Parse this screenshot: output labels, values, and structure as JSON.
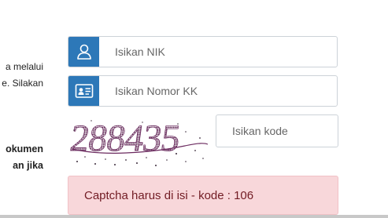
{
  "left_fragments": [
    {
      "text": "a melalui",
      "bold": false
    },
    {
      "text": "e. Silakan",
      "bold": false
    },
    {
      "text": "okumen",
      "bold": true
    },
    {
      "text": "an jika",
      "bold": true
    }
  ],
  "form": {
    "nik": {
      "placeholder": "Isikan NIK",
      "icon": "user-icon"
    },
    "kk": {
      "placeholder": "Isikan Nomor KK",
      "icon": "id-card-icon"
    },
    "captcha": {
      "image_text": "288435",
      "input_placeholder": "Isikan kode"
    }
  },
  "alert": {
    "message": "Captcha harus di isi - kode : 106"
  },
  "colors": {
    "addon": "#2d78b8",
    "alert_bg": "#f8d7da",
    "alert_text": "#721c24"
  }
}
